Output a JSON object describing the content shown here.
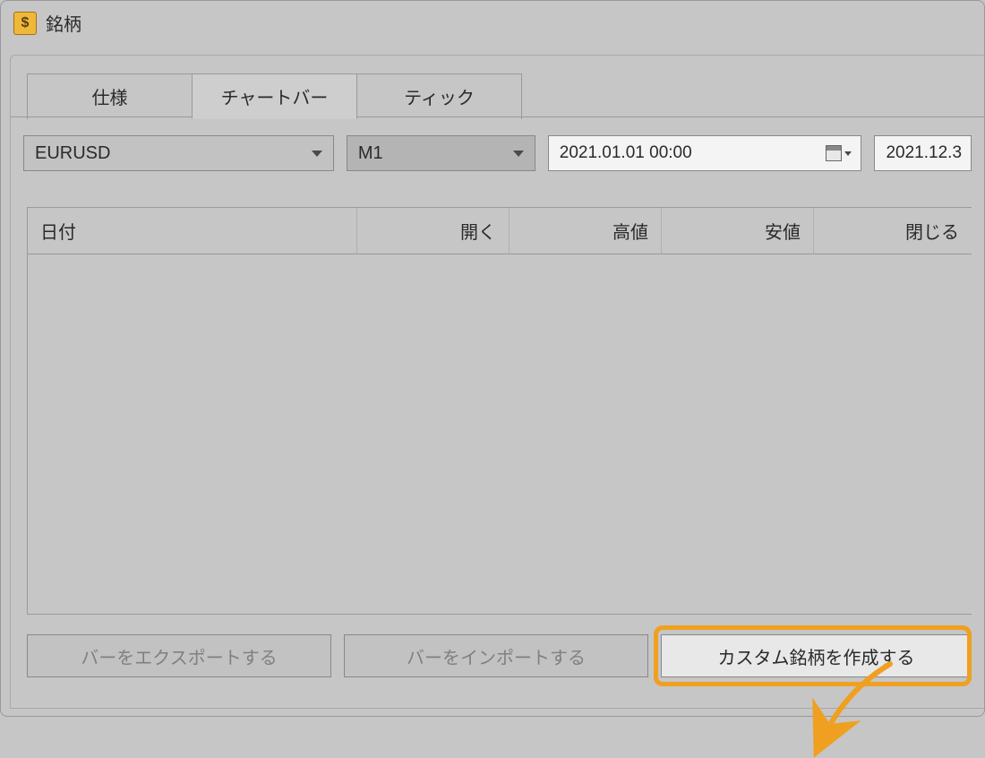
{
  "window": {
    "title": "銘柄"
  },
  "tabs": [
    {
      "label": "仕様",
      "active": false
    },
    {
      "label": "チャートバー",
      "active": true
    },
    {
      "label": "ティック",
      "active": false
    }
  ],
  "controls": {
    "symbol": "EURUSD",
    "timeframe": "M1",
    "date_start": "2021.01.01 00:00",
    "date_end": "2021.12.3"
  },
  "table": {
    "columns": [
      "日付",
      "開く",
      "高値",
      "安値",
      "閉じる"
    ],
    "rows": []
  },
  "buttons": {
    "export": "バーをエクスポートする",
    "import": "バーをインポートする",
    "create_custom": "カスタム銘柄を作成する"
  }
}
